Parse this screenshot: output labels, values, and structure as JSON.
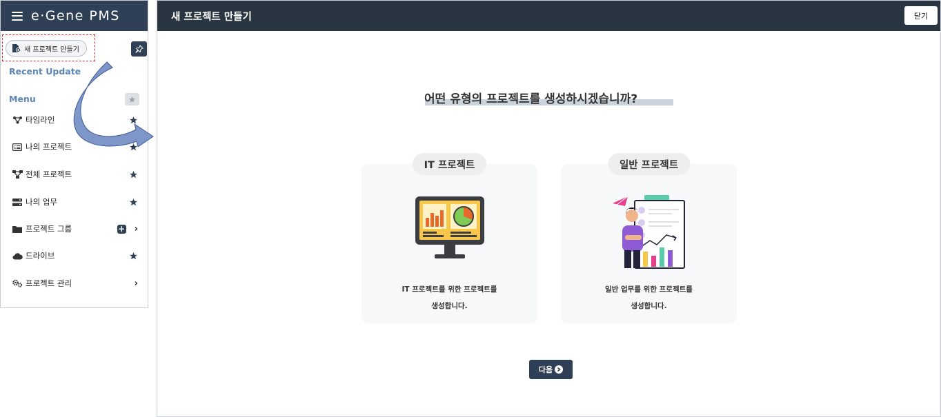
{
  "sidebar": {
    "brand": "e·Gene PMS",
    "new_project_button": "새 프로젝트 만들기",
    "recent_update": "Recent Update",
    "menu_label": "Menu",
    "items": [
      {
        "label": "타임라인",
        "icon": "timeline-icon"
      },
      {
        "label": "나의 프로젝트",
        "icon": "list-icon"
      },
      {
        "label": "전체 프로젝트",
        "icon": "sitemap-icon"
      },
      {
        "label": "나의 업무",
        "icon": "tasks-icon"
      },
      {
        "label": "프로젝트 그룹",
        "icon": "folder-icon"
      },
      {
        "label": "드라이브",
        "icon": "cloud-icon"
      },
      {
        "label": "프로젝트 관리",
        "icon": "gears-icon"
      }
    ]
  },
  "modal": {
    "title": "새 프로젝트 만들기",
    "close_label": "닫기",
    "question": "어떤 유형의 프로젝트를 생성하시겠습니까?",
    "cards": [
      {
        "title": "IT 프로젝트",
        "desc_line1": "IT 프로젝트를 위한 프로젝트를",
        "desc_line2": "생성합니다."
      },
      {
        "title": "일반 프로젝트",
        "desc_line1": "일반 업무를 위한 프로젝트를",
        "desc_line2": "생성합니다."
      }
    ],
    "next_label": "다음"
  },
  "colors": {
    "sidebar_header": "#2e3f56",
    "modal_header": "#2a3542",
    "menu_label": "#5b86b5",
    "annotation_dash": "#d9251d",
    "annotation_arrow": "#7e97c8"
  }
}
